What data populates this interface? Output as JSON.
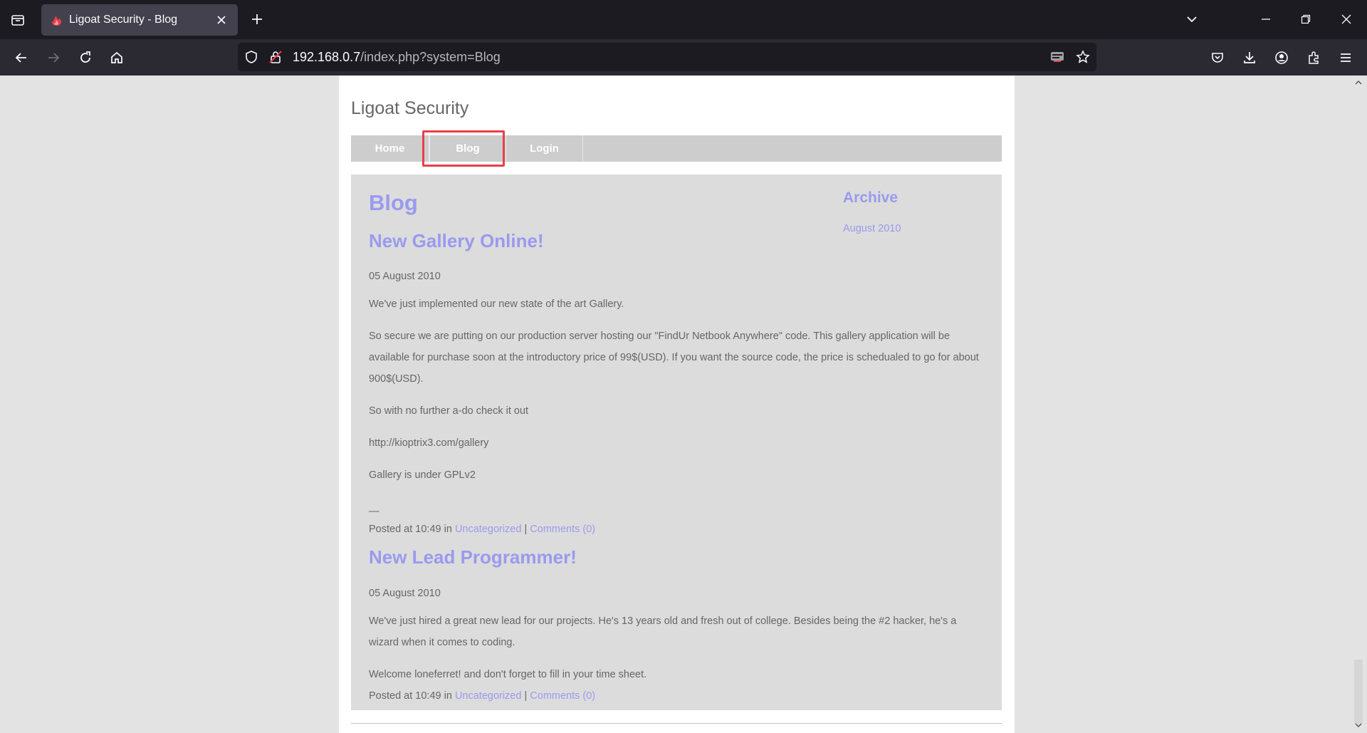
{
  "browser": {
    "tab_title": "Ligoat Security - Blog",
    "url_host": "192.168.0.7",
    "url_path": "/index.php?system=Blog"
  },
  "site": {
    "title": "Ligoat Security",
    "menu": [
      "Home",
      "Blog",
      "Login"
    ],
    "heading": "Blog",
    "sidebar": {
      "title": "Archive",
      "link": "August 2010"
    },
    "posts": [
      {
        "title": "New Gallery Online!",
        "date": "05 August 2010",
        "paragraphs": [
          "We've just implemented our new state of the art Gallery.",
          "So secure we are putting on our production server hosting our \"FindUr Netbook Anywhere\" code. This gallery application will be available for purchase soon at the introductory price of 99$(USD). If you want the source code, the price is schedualed to go for about 900$(USD).",
          "So with no further a-do check it out",
          "http://kioptrix3.com/gallery",
          "Gallery is under GPLv2"
        ],
        "separator": "—",
        "posted": "Posted at 10:49 in",
        "category": "Uncategorized",
        "divider": "|",
        "comments": "Comments (0)"
      },
      {
        "title": "New Lead Programmer!",
        "date": "05 August 2010",
        "paragraphs": [
          "We've just hired a great new lead for our projects. He's 13 years old and fresh out of college. Besides being the #2 hacker, he's a wizard when it comes to coding.",
          "Welcome loneferret! and don't forget to fill in your time sheet."
        ],
        "posted": "Posted at 10:49 in",
        "category": "Uncategorized",
        "divider": "|",
        "comments": "Comments (0)"
      }
    ]
  }
}
